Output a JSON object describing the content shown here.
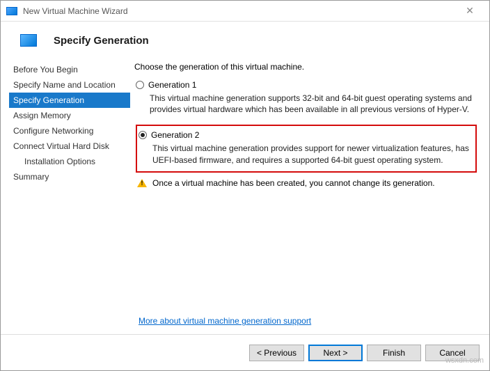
{
  "window": {
    "title": "New Virtual Machine Wizard"
  },
  "header": {
    "title": "Specify Generation"
  },
  "sidebar": {
    "items": [
      {
        "label": "Before You Begin"
      },
      {
        "label": "Specify Name and Location"
      },
      {
        "label": "Specify Generation"
      },
      {
        "label": "Assign Memory"
      },
      {
        "label": "Configure Networking"
      },
      {
        "label": "Connect Virtual Hard Disk"
      },
      {
        "label": "Installation Options"
      },
      {
        "label": "Summary"
      }
    ]
  },
  "content": {
    "prompt": "Choose the generation of this virtual machine.",
    "gen1": {
      "label": "Generation 1",
      "desc": "This virtual machine generation supports 32-bit and 64-bit guest operating systems and provides virtual hardware which has been available in all previous versions of Hyper-V."
    },
    "gen2": {
      "label": "Generation 2",
      "desc": "This virtual machine generation provides support for newer virtualization features, has UEFI-based firmware, and requires a supported 64-bit guest operating system."
    },
    "note": "Once a virtual machine has been created, you cannot change its generation.",
    "link": "More about virtual machine generation support"
  },
  "footer": {
    "previous": "< Previous",
    "next": "Next >",
    "finish": "Finish",
    "cancel": "Cancel"
  },
  "watermark": "wsxdn.com"
}
